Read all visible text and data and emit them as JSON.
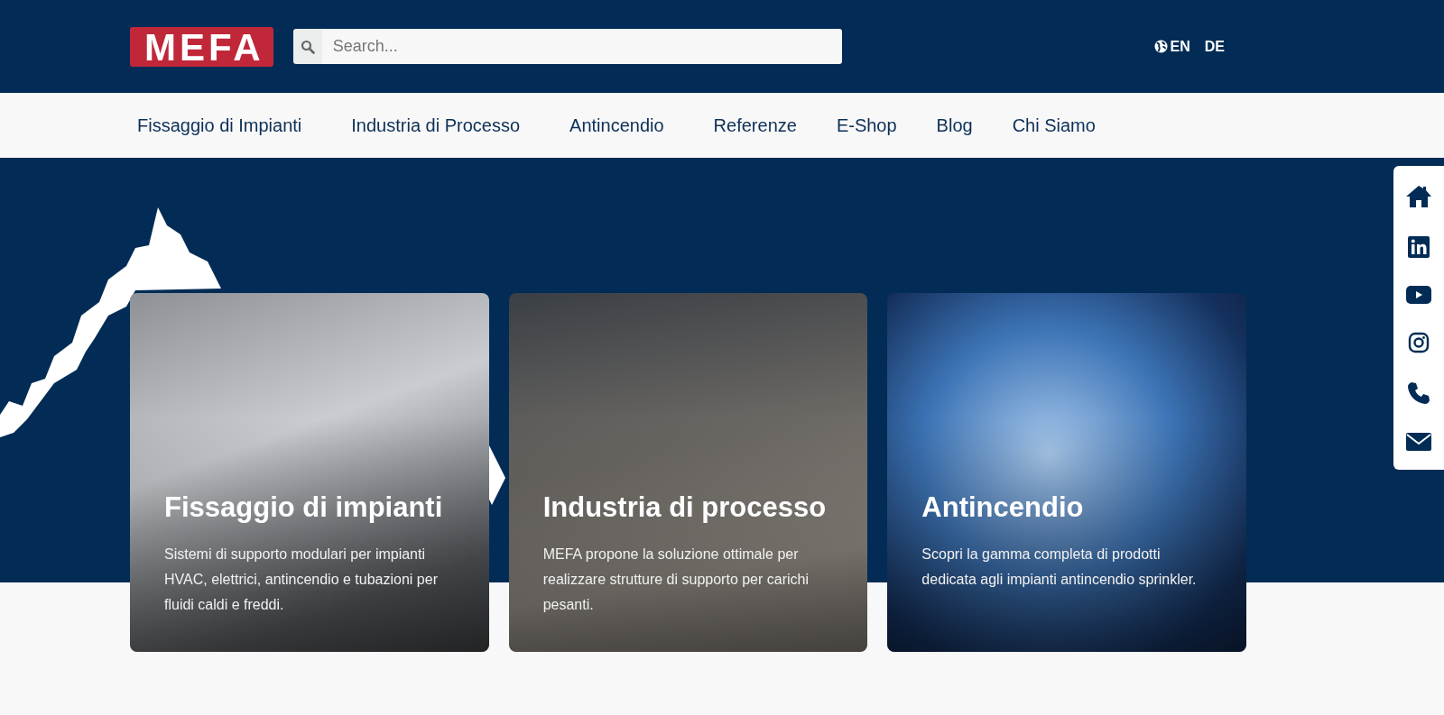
{
  "header": {
    "logo": "MEFA",
    "search": {
      "placeholder": "Search..."
    },
    "languages": [
      "EN",
      "DE"
    ]
  },
  "nav": {
    "items": [
      "Fissaggio di Impianti",
      "Industria di Processo",
      "Antincendio",
      "Referenze",
      "E-Shop",
      "Blog",
      "Chi Siamo"
    ]
  },
  "cards": [
    {
      "title": "Fissaggio di impianti",
      "text": "Sistemi di supporto modulari per impianti HVAC, elettrici, antincendio e tubazioni per fluidi caldi e freddi."
    },
    {
      "title": "Industria di processo",
      "text": "MEFA propone la soluzione ottimale per realizzare strutture di supporto per carichi pesanti."
    },
    {
      "title": "Antincendio",
      "text": "Scopri la gamma completa di prodotti dedicata agli impianti antincendio sprinkler."
    }
  ]
}
